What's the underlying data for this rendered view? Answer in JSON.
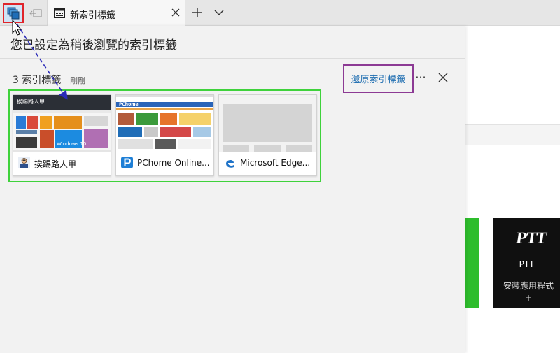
{
  "tabbar": {
    "active_tab_title": "新索引標籤"
  },
  "panel": {
    "heading": "您已設定為稍後瀏覽的索引標籤",
    "group_count": "3 索引標籤",
    "group_time": "剛剛",
    "restore_label": "還原索引標籤",
    "more_label": "···"
  },
  "tabs": [
    {
      "title": "挨踢路人甲",
      "icon": "avatar-icon"
    },
    {
      "title": "PChome Online...",
      "icon": "pchome-icon"
    },
    {
      "title": "Microsoft Edge...",
      "icon": "edge-icon"
    }
  ],
  "tile_thumbs": {
    "t1_header": "挨踢路人甲",
    "t1_win": "Windows 10",
    "t2_brand": "PChome"
  },
  "background": {
    "ptt_logo": "PTT",
    "ptt_name": "PTT",
    "ptt_install": "安裝應用程式 +"
  },
  "colors": {
    "highlight_red": "#e0242a",
    "highlight_purple": "#8c3a94",
    "highlight_green": "#3fd23c",
    "link_blue": "#1c6cb0",
    "arrow_blue": "#2a2ab8"
  }
}
